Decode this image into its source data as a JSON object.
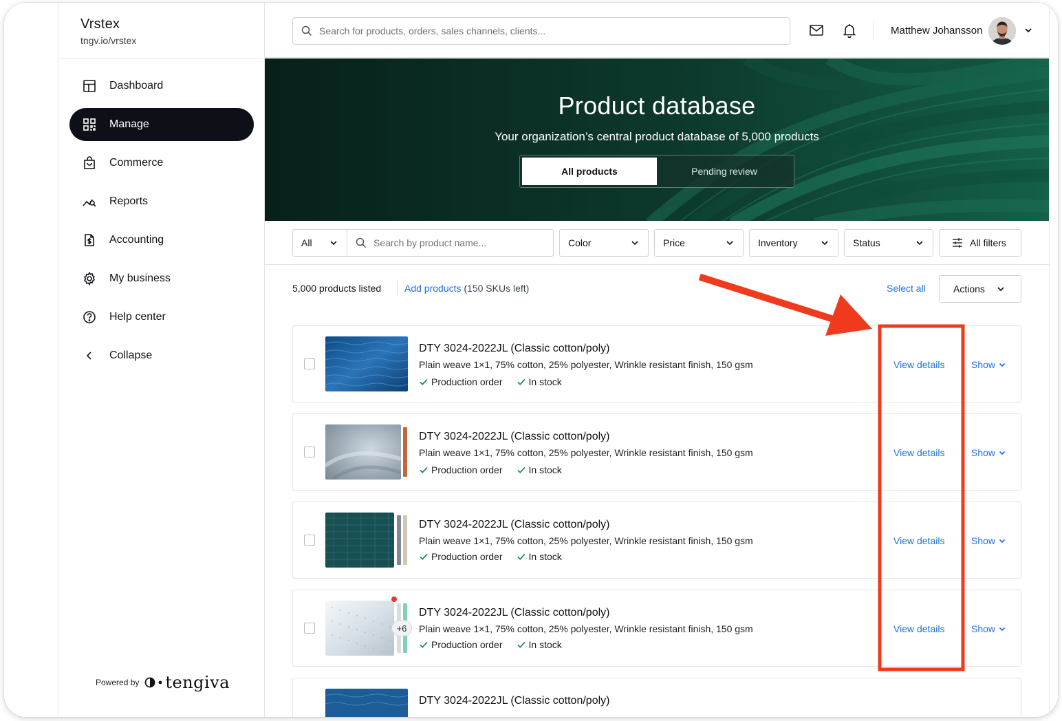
{
  "app": {
    "name": "Vrstex",
    "url": "tngv.io/vrstex"
  },
  "nav": {
    "items": [
      {
        "label": "Dashboard",
        "icon": "dashboard-icon",
        "active": false
      },
      {
        "label": "Manage",
        "icon": "grid-icon",
        "active": true
      },
      {
        "label": "Commerce",
        "icon": "shopping-bag-icon",
        "active": false
      },
      {
        "label": "Reports",
        "icon": "chart-icon",
        "active": false
      },
      {
        "label": "Accounting",
        "icon": "dollar-document-icon",
        "active": false
      },
      {
        "label": "My business",
        "icon": "gear-icon",
        "active": false
      },
      {
        "label": "Help center",
        "icon": "help-icon",
        "active": false
      },
      {
        "label": "Collapse",
        "icon": "chevron-left-icon",
        "active": false
      }
    ]
  },
  "powered": {
    "text": "Powered by",
    "logo": "tengiva"
  },
  "topbar": {
    "search_placeholder": "Search for products, orders, sales channels, clients...",
    "user_name": "Matthew Johansson"
  },
  "hero": {
    "title": "Product database",
    "subtitle": "Your organization’s central product database of 5,000 products",
    "tabs": [
      {
        "label": "All products",
        "active": true
      },
      {
        "label": "Pending review",
        "active": false
      }
    ]
  },
  "filters": {
    "scope": "All",
    "search_placeholder": "Search by product name...",
    "color": "Color",
    "price": "Price",
    "inventory": "Inventory",
    "status": "Status",
    "all_filters": "All filters"
  },
  "listbar": {
    "count": "5,000 products listed",
    "add_link": "Add products",
    "skus_left": "(150 SKUs left)",
    "select_all": "Select all",
    "actions": "Actions"
  },
  "products": [
    {
      "title": "DTY 3024-2022JL (Classic cotton/poly)",
      "description": "Plain weave 1×1, 75% cotton, 25% polyester, Wrinkle resistant finish, 150 gsm",
      "tags": [
        "Production order",
        "In stock"
      ],
      "view": "View details",
      "show": "Show"
    },
    {
      "title": "DTY 3024-2022JL (Classic cotton/poly)",
      "description": "Plain weave 1×1, 75% cotton, 25% polyester, Wrinkle resistant finish, 150 gsm",
      "tags": [
        "Production order",
        "In stock"
      ],
      "view": "View details",
      "show": "Show"
    },
    {
      "title": "DTY 3024-2022JL (Classic cotton/poly)",
      "description": "Plain weave 1×1, 75% cotton, 25% polyester, Wrinkle resistant finish, 150 gsm",
      "tags": [
        "Production order",
        "In stock"
      ],
      "view": "View details",
      "show": "Show"
    },
    {
      "title": "DTY 3024-2022JL (Classic cotton/poly)",
      "description": "Plain weave 1×1, 75% cotton, 25% polyester, Wrinkle resistant finish, 150 gsm",
      "tags": [
        "Production order",
        "In stock"
      ],
      "view": "View details",
      "show": "Show",
      "more_count": "+6"
    },
    {
      "title": "DTY 3024-2022JL (Classic cotton/poly)"
    }
  ],
  "colors": {
    "link": "#1f6feb",
    "nav_active": "#0d1117",
    "hero_bg": "#0b2a22",
    "check_green": "#1f8a5a",
    "annotation_red": "#f03a1d"
  }
}
